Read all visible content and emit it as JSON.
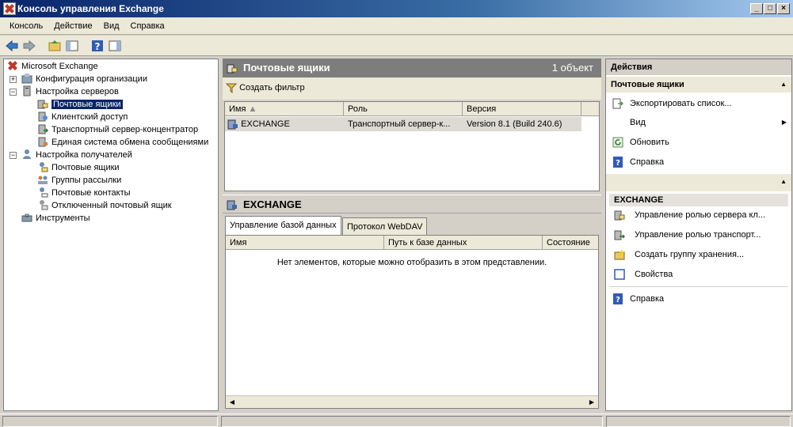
{
  "window": {
    "title": "Консоль управления Exchange",
    "min": "_",
    "max": "□",
    "close": "×"
  },
  "menu": [
    "Консоль",
    "Действие",
    "Вид",
    "Справка"
  ],
  "tree": {
    "root": "Microsoft Exchange",
    "org_config": "Конфигурация организации",
    "server_config": "Настройка серверов",
    "mailboxes": "Почтовые ящики",
    "client_access": "Клиентский доступ",
    "hub_transport": "Транспортный сервер-концентратор",
    "unified_messaging": "Единая система обмена сообщениями",
    "recipient_config": "Настройка получателей",
    "recipient_mailboxes": "Почтовые ящики",
    "distribution_groups": "Группы рассылки",
    "mail_contacts": "Почтовые контакты",
    "disconnected_mailbox": "Отключенный почтовый ящик",
    "toolbox": "Инструменты"
  },
  "center": {
    "header_title": "Почтовые ящики",
    "header_count": "1 объект",
    "create_filter": "Создать фильтр",
    "columns": [
      "Имя",
      "Роль",
      "Версия"
    ],
    "rows": [
      {
        "name": "EXCHANGE",
        "role": "Транспортный сервер-к...",
        "version": "Version 8.1 (Build 240.6)"
      }
    ],
    "detail_title": "EXCHANGE",
    "tabs": [
      "Управление базой данных",
      "Протокол WebDAV"
    ],
    "detail_columns": [
      "Имя",
      "Путь к базе данных",
      "Состояние"
    ],
    "empty_message": "Нет элементов, которые можно отобразить в этом представлении."
  },
  "actions": {
    "title": "Действия",
    "section1": "Почтовые ящики",
    "export": "Экспортировать список...",
    "view": "Вид",
    "refresh": "Обновить",
    "help": "Справка",
    "section2": "EXCHANGE",
    "manage_mailbox_role": "Управление ролью сервера кл...",
    "manage_transport_role": "Управление ролью транспорт...",
    "create_storage_group": "Создать группу хранения...",
    "properties": "Свойства",
    "help2": "Справка"
  }
}
